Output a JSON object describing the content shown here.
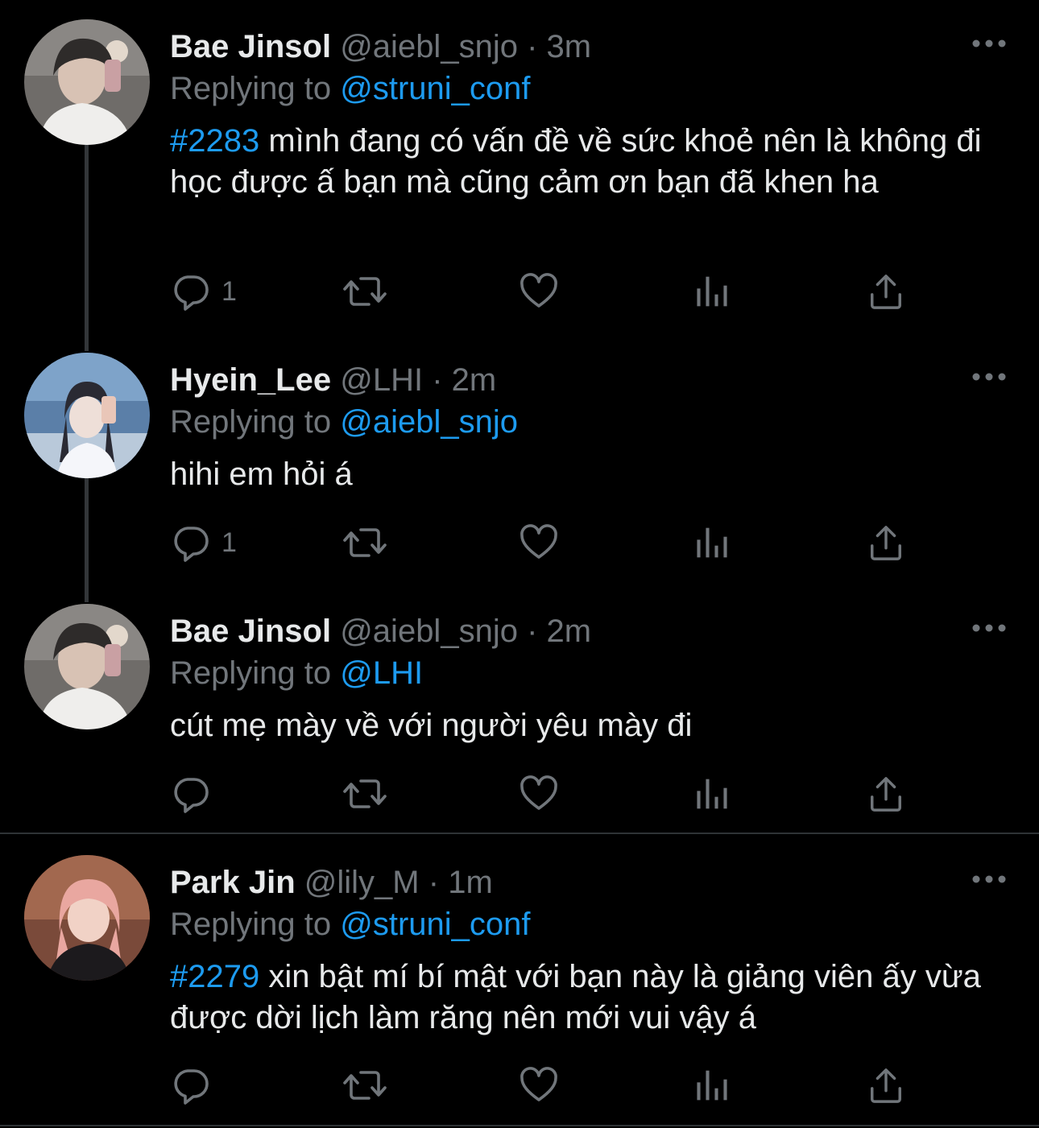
{
  "tweets": [
    {
      "name": "Bae Jinsol",
      "handle": "@aiebl_snjo",
      "time": "3m",
      "reply_prefix": "Replying to",
      "reply_to": "@struni_conf",
      "hashtag": "#2283",
      "text": " mình đang có vấn đề về sức khoẻ nên là không đi học được ấ bạn mà cũng cảm ơn bạn đã khen ha",
      "reply_count": "1",
      "avatar": "avatar-bae-jinsol"
    },
    {
      "name": "Hyein_Lee",
      "handle": "@LHI",
      "time": "2m",
      "reply_prefix": "Replying to",
      "reply_to": "@aiebl_snjo",
      "hashtag": "",
      "text": "hihi em hỏi á",
      "reply_count": "1",
      "avatar": "avatar-hyein-lee"
    },
    {
      "name": "Bae Jinsol",
      "handle": "@aiebl_snjo",
      "time": "2m",
      "reply_prefix": "Replying to",
      "reply_to": "@LHI",
      "hashtag": "",
      "text": "cút mẹ mày về với người yêu mày đi",
      "reply_count": "",
      "avatar": "avatar-bae-jinsol"
    },
    {
      "name": "Park Jin",
      "handle": "@lily_M",
      "time": "1m",
      "reply_prefix": "Replying to",
      "reply_to": "@struni_conf",
      "hashtag": "#2279",
      "text": " xin bật mí bí mật với bạn này là giảng viên ấy vừa được dời lịch làm răng nên mới vui vậy á",
      "reply_count": "",
      "avatar": "avatar-park-jin"
    }
  ],
  "separator": "·",
  "icons": [
    "reply-icon",
    "retweet-icon",
    "like-icon",
    "analytics-icon",
    "share-icon",
    "more-icon"
  ],
  "colors": {
    "background": "#000000",
    "text": "#E7E9EA",
    "muted": "#71767B",
    "accent": "#1D9BF0",
    "thread_line": "#333639",
    "divider": "#2F3336"
  }
}
